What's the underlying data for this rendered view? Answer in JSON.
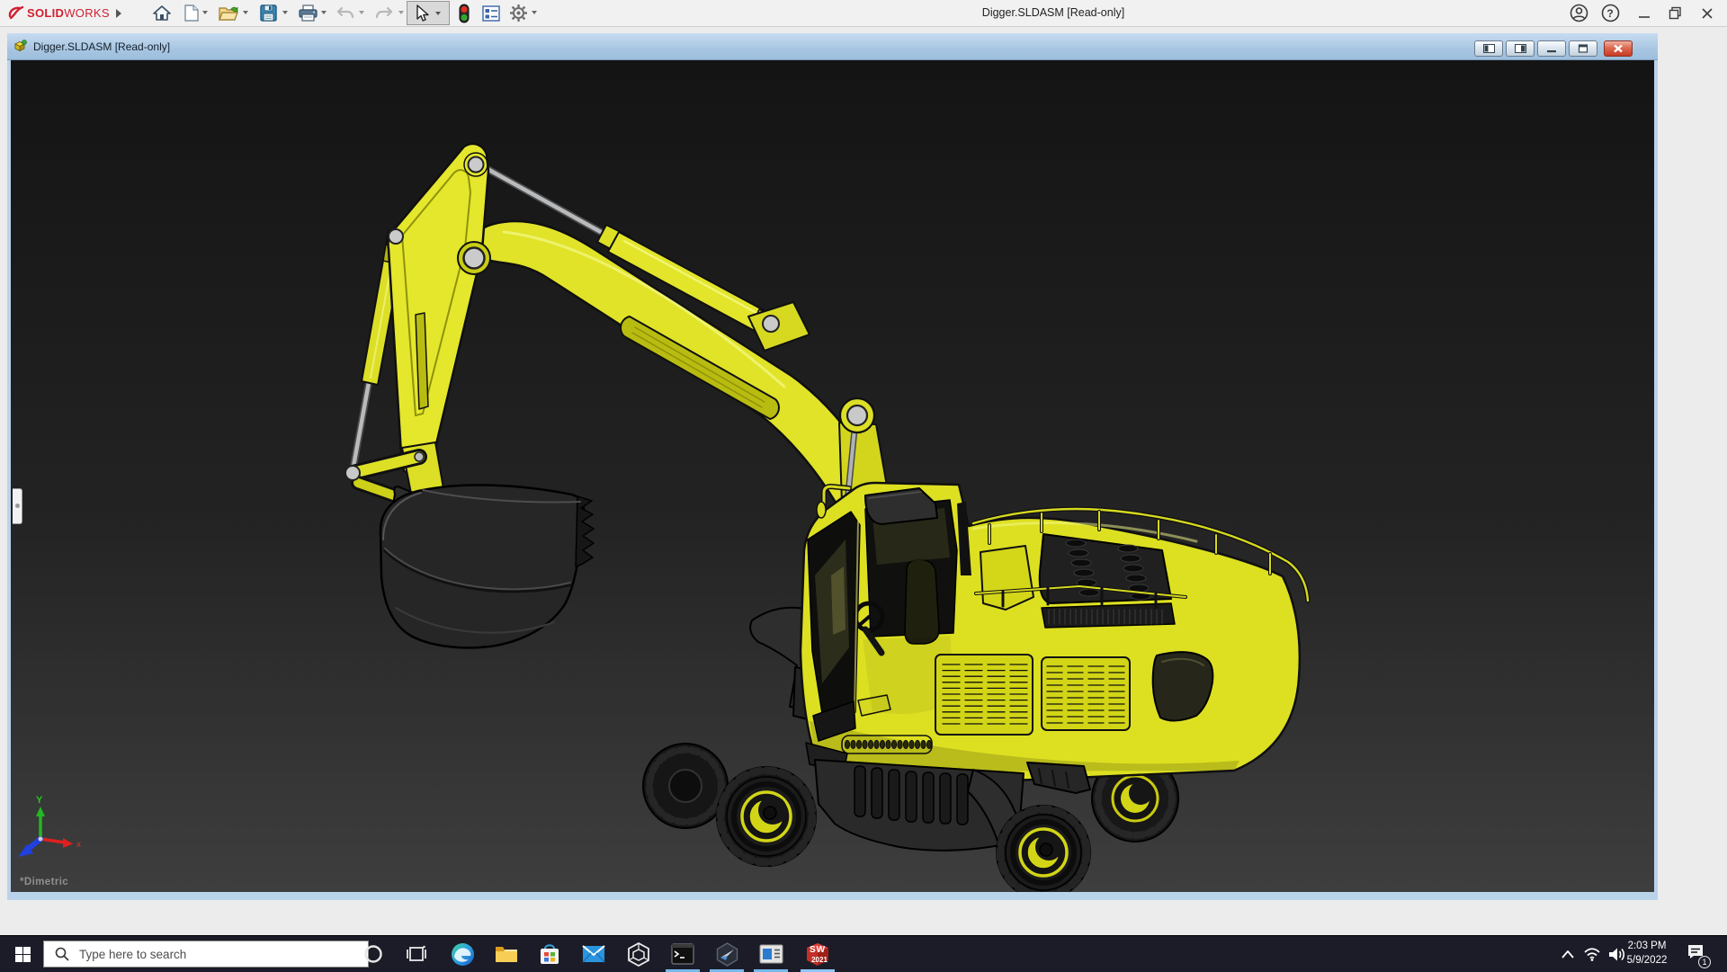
{
  "app": {
    "brand": {
      "solid": "SOLID",
      "works": "WORKS"
    },
    "title": "Digger.SLDASM [Read-only]",
    "controls": {
      "help_glyph": "?"
    }
  },
  "child_window": {
    "title": "Digger.SLDASM [Read-only]"
  },
  "viewport": {
    "orientation_label": "*Dimetric",
    "triad": {
      "y_label": "Y",
      "x_label": "x"
    },
    "model_name": "Digger excavator assembly",
    "model_color": "#dde021"
  },
  "taskbar": {
    "search_placeholder": "Type here to search",
    "apps": [
      {
        "name": "edge",
        "running": false
      },
      {
        "name": "file-explorer",
        "running": false
      },
      {
        "name": "store",
        "running": false
      },
      {
        "name": "mail",
        "running": false
      },
      {
        "name": "3d-viewer",
        "running": false
      },
      {
        "name": "command-prompt",
        "running": true
      },
      {
        "name": "cad-assistant",
        "running": true
      },
      {
        "name": "reader",
        "running": true
      },
      {
        "name": "solidworks-2021",
        "running": true
      }
    ],
    "solidworks_icon": {
      "label": "SW",
      "year": "2021"
    },
    "tray": {
      "time": "2:03 PM",
      "date": "5/9/2022",
      "notification_count": "1"
    }
  },
  "colors": {
    "titlebar_bg": "#f1f1f1",
    "child_titlebar_top": "#c6dbf0",
    "child_titlebar_bottom": "#9cbedd",
    "viewport_top": "#141414",
    "viewport_bottom": "#3e3e3e",
    "taskbar_bg": "#1b1c28",
    "running_underline": "#76b9ed",
    "close_red": "#c83a22",
    "excavator_yellow": "#dde021"
  }
}
